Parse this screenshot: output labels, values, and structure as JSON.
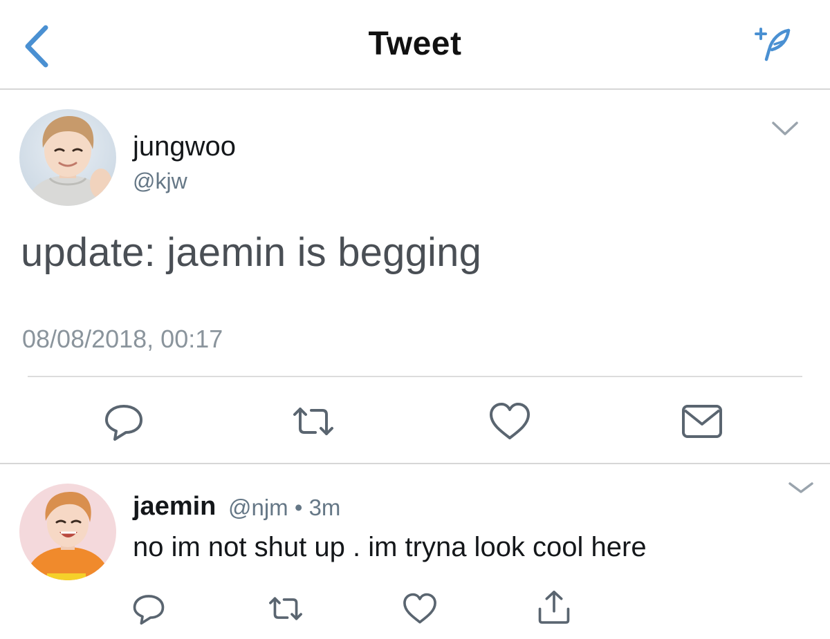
{
  "header": {
    "title": "Tweet",
    "back_icon": "chevron-left-icon",
    "compose_icon": "compose-feather-icon",
    "accent_color": "#4a90d2"
  },
  "main_tweet": {
    "display_name": "jungwoo",
    "handle": "@kjw",
    "text": "update: jaemin is begging",
    "timestamp": "08/08/2018, 00:17",
    "menu_icon": "chevron-down-icon",
    "actions": [
      "reply-icon",
      "retweet-icon",
      "like-icon",
      "message-icon"
    ]
  },
  "reply": {
    "display_name": "jaemin",
    "handle": "@njm",
    "separator": "•",
    "time": "3m",
    "meta": "@njm • 3m",
    "text": "no im not shut up . im tryna look cool here",
    "menu_icon": "chevron-down-icon",
    "actions": [
      "reply-icon",
      "retweet-icon",
      "like-icon",
      "share-icon"
    ]
  },
  "colors": {
    "text_primary": "#14171a",
    "text_secondary": "#657786",
    "icon_gray": "#5a6570",
    "divider": "#d6d6d6"
  }
}
